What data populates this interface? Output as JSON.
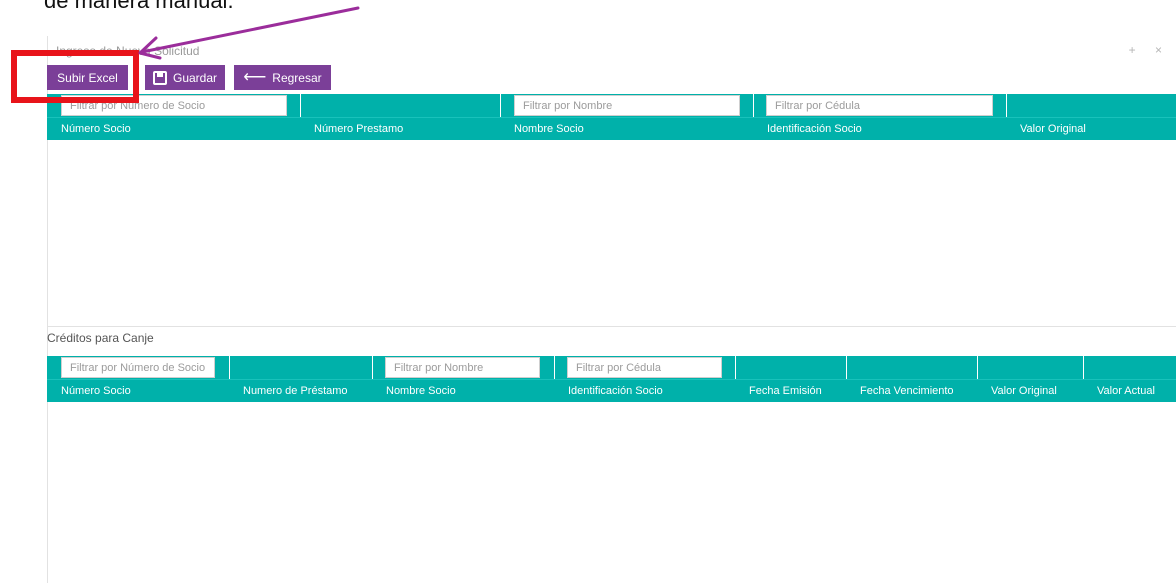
{
  "caption": "de manera manual.",
  "panel": {
    "title": "Ingreso de Nueva Solicitud",
    "controls": "+ ×"
  },
  "toolbar": {
    "upload_label": "Subir Excel",
    "save_label": "Guardar",
    "back_label": "Regresar",
    "save_icon": "floppy-disk-icon",
    "back_icon": "arrow-left-icon"
  },
  "grid1": {
    "filters": {
      "socio": "Filtrar por Número de Socio",
      "nombre": "Filtrar por Nombre",
      "cedula": "Filtrar por Cédula"
    },
    "columns": [
      "Número Socio",
      "Número Prestamo",
      "Nombre Socio",
      "Identificación Socio",
      "Valor Original"
    ]
  },
  "section2": {
    "title": "Créditos para Canje"
  },
  "grid2": {
    "filters": {
      "socio": "Filtrar por Número de Socio",
      "nombre": "Filtrar por Nombre",
      "cedula": "Filtrar por Cédula"
    },
    "columns": [
      "Número Socio",
      "Numero de Préstamo",
      "Nombre Socio",
      "Identificación Socio",
      "Fecha Emisión",
      "Fecha Vencimiento",
      "Valor Original",
      "Valor Actual"
    ]
  },
  "annotation": {
    "highlight_color": "#e8141a",
    "arrow_color": "#9b2d9b"
  },
  "colors": {
    "accent_purple": "#7b3f98",
    "grid_teal": "#00b1aa"
  }
}
